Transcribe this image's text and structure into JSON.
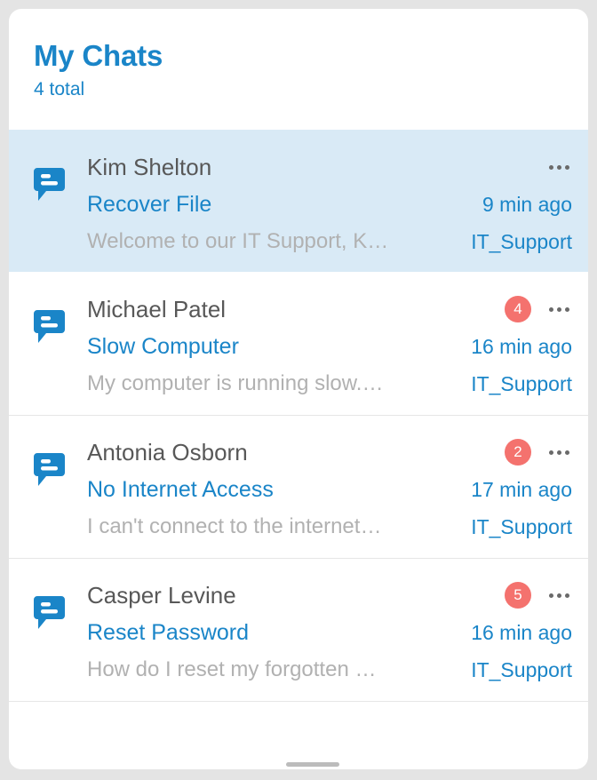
{
  "header": {
    "title": "My Chats",
    "subtitle": "4 total"
  },
  "colors": {
    "accent": "#1a85c8",
    "badge": "#f4726e",
    "selected_row_bg": "#d9eaf6",
    "card_bg": "#ffffff",
    "page_bg": "#e4e4e4",
    "name_text": "#585858",
    "preview_text": "#b1b1b1",
    "divider": "#e6e6e6"
  },
  "icons": {
    "chat_bubble": "chat-bubble-icon",
    "more": "more-horizontal-icon"
  },
  "chats": [
    {
      "name": "Kim Shelton",
      "subject": "Recover File",
      "preview": "Welcome to our IT Support, K…",
      "time": "9 min ago",
      "channel": "IT_Support",
      "unread": "",
      "selected": true
    },
    {
      "name": "Michael Patel",
      "subject": "Slow Computer",
      "preview": "My computer is running slow.…",
      "time": "16 min ago",
      "channel": "IT_Support",
      "unread": "4",
      "selected": false
    },
    {
      "name": "Antonia Osborn",
      "subject": "No Internet Access",
      "preview": "I can't connect to the internet…",
      "time": "17 min ago",
      "channel": "IT_Support",
      "unread": "2",
      "selected": false
    },
    {
      "name": "Casper Levine",
      "subject": "Reset Password",
      "preview": "How do I reset my forgotten …",
      "time": "16 min ago",
      "channel": "IT_Support",
      "unread": "5",
      "selected": false
    }
  ]
}
